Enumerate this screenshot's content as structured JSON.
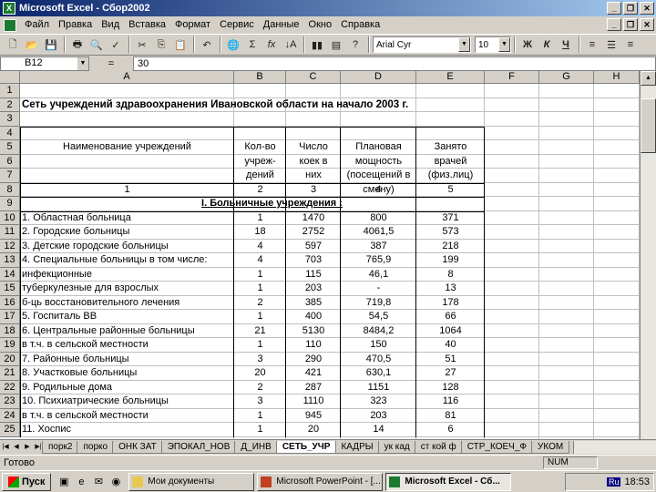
{
  "window": {
    "title": "Microsoft Excel - Сбор2002"
  },
  "menu": [
    "Файл",
    "Правка",
    "Вид",
    "Вставка",
    "Формат",
    "Сервис",
    "Данные",
    "Окно",
    "Справка"
  ],
  "toolbar": {
    "font_name": "Arial Cyr",
    "font_size": "10"
  },
  "formula_bar": {
    "cell_ref": "B12",
    "equals": "=",
    "value": "30"
  },
  "columns": [
    "A",
    "B",
    "C",
    "D",
    "E",
    "F",
    "G",
    "H"
  ],
  "rows": [
    "1",
    "2",
    "3",
    "4",
    "5",
    "6",
    "7",
    "8",
    "9",
    "10",
    "11",
    "12",
    "13",
    "14",
    "15",
    "16",
    "17",
    "18",
    "19",
    "20",
    "21",
    "22",
    "23",
    "24",
    "25"
  ],
  "sheet": {
    "title": "Сеть учреждений здравоохранения Ивановской области на начало 2003 г.",
    "header": {
      "name": "Наименование  учреждений",
      "b": [
        "Кол-во",
        "учреж-",
        "дений"
      ],
      "c": [
        "Число",
        "коек в",
        "них"
      ],
      "d": [
        "Плановая",
        "мощность",
        "(посещений в",
        "смену)"
      ],
      "e": [
        "Занято",
        "врачей",
        "(физ.лиц)"
      ]
    },
    "numbering": [
      "1",
      "2",
      "3",
      "4",
      "5"
    ],
    "section": "I. Больничные учреждения :",
    "data": [
      {
        "row": "10",
        "name": "1.  Областная больница",
        "b": "1",
        "c": "1470",
        "d": "800",
        "e": "371"
      },
      {
        "row": "11",
        "name": "2.  Городские больницы",
        "b": "18",
        "c": "2752",
        "d": "4061,5",
        "e": "573"
      },
      {
        "row": "12",
        "name": "3.  Детские городские больницы",
        "b": "4",
        "c": "597",
        "d": "387",
        "e": "218"
      },
      {
        "row": "13",
        "name": "4.  Специальные больницы в том числе:",
        "b": "4",
        "c": "703",
        "d": "765,9",
        "e": "199"
      },
      {
        "row": "14",
        "name": "      инфекционные",
        "b": "1",
        "c": "115",
        "d": "46,1",
        "e": "8"
      },
      {
        "row": "15",
        "name": "      туберкулезные для взрослых",
        "b": "1",
        "c": "203",
        "d": "-",
        "e": "13"
      },
      {
        "row": "16",
        "name": "      б-ць восстановительного лечения",
        "b": "2",
        "c": "385",
        "d": "719,8",
        "e": "178"
      },
      {
        "row": "17",
        "name": "5.  Госпиталь ВВ",
        "b": "1",
        "c": "400",
        "d": "54,5",
        "e": "66"
      },
      {
        "row": "18",
        "name": "6.  Центральные районные больницы",
        "b": "21",
        "c": "5130",
        "d": "8484,2",
        "e": "1064"
      },
      {
        "row": "19",
        "name": "      в т.ч. в сельской местности",
        "b": "1",
        "c": "110",
        "d": "150",
        "e": "40"
      },
      {
        "row": "20",
        "name": "7.  Районные  больницы",
        "b": "3",
        "c": "290",
        "d": "470,5",
        "e": "51"
      },
      {
        "row": "21",
        "name": "8.  Участковые больницы",
        "b": "20",
        "c": "421",
        "d": "630,1",
        "e": "27"
      },
      {
        "row": "22",
        "name": "9.  Родильные дома",
        "b": "2",
        "c": "287",
        "d": "1151",
        "e": "128"
      },
      {
        "row": "23",
        "name": "10.   Психиатрические больницы",
        "b": "3",
        "c": "1110",
        "d": "323",
        "e": "116"
      },
      {
        "row": "24",
        "name": "      в т.ч. в сельской местности",
        "b": "1",
        "c": "945",
        "d": "203",
        "e": "81"
      },
      {
        "row": "25",
        "name": "11. Хоспис",
        "b": "1",
        "c": "20",
        "d": "14",
        "e": "6"
      }
    ]
  },
  "tabs": [
    "порк2",
    "порко",
    "ОНК ЗАТ",
    "ЭПОКАЛ_НОВ",
    "Д_ИНВ",
    "СЕТЬ_УЧР",
    "КАДРЫ",
    "ук кад",
    "ст кой ф",
    "СТР_КОЕЧ_Ф",
    "УКОМ"
  ],
  "active_tab": "СЕТЬ_УЧР",
  "status": {
    "text": "Готово",
    "num": "NUM"
  },
  "taskbar": {
    "start": "Пуск",
    "tasks": [
      "Мои документы",
      "Microsoft PowerPoint - [...",
      "Microsoft Excel - Сб..."
    ],
    "lang": "Ru",
    "clock": "18:53"
  },
  "colors": {
    "title_start": "#0a246a",
    "title_end": "#a6caf0",
    "face": "#d4d0c8"
  }
}
